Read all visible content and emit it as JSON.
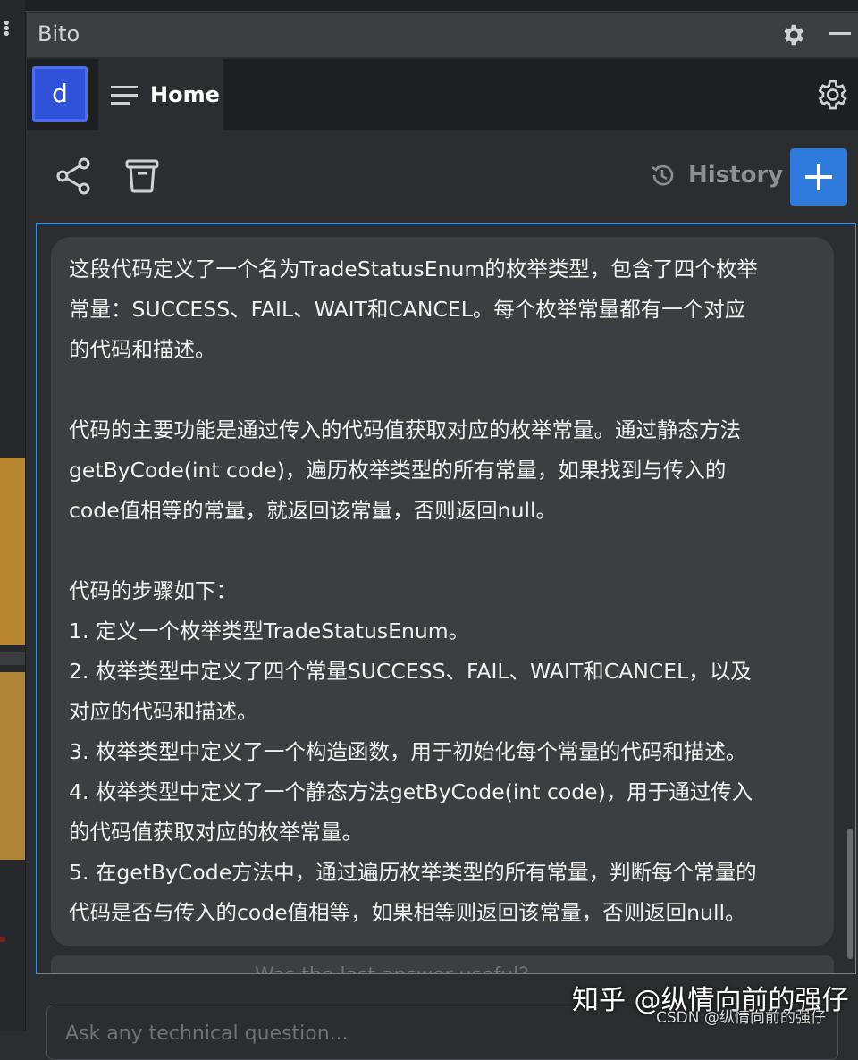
{
  "window": {
    "title": "Bito"
  },
  "tabs": {
    "avatar_letter": "d",
    "home_label": "Home"
  },
  "toolbar": {
    "history_label": "History"
  },
  "answer": {
    "lines": [
      "这段代码定义了一个名为TradeStatusEnum的枚举类型，包含了四个枚举",
      "常量：SUCCESS、FAIL、WAIT和CANCEL。每个枚举常量都有一个对应",
      "的代码和描述。",
      "",
      "代码的主要功能是通过传入的代码值获取对应的枚举常量。通过静态方法",
      "getByCode(int code)，遍历枚举类型的所有常量，如果找到与传入的",
      "code值相等的常量，就返回该常量，否则返回null。",
      "",
      "代码的步骤如下：",
      "1. 定义一个枚举类型TradeStatusEnum。",
      "2. 枚举类型中定义了四个常量SUCCESS、FAIL、WAIT和CANCEL，以及",
      "对应的代码和描述。",
      "3. 枚举类型中定义了一个构造函数，用于初始化每个常量的代码和描述。",
      "4. 枚举类型中定义了一个静态方法getByCode(int code)，用于通过传入",
      "的代码值获取对应的枚举常量。",
      "5. 在getByCode方法中，通过遍历枚举类型的所有常量，判断每个常量的",
      "代码是否与传入的code值相等，如果相等则返回该常量，否则返回null。"
    ]
  },
  "feedback": {
    "question": "Was the last answer useful?"
  },
  "input": {
    "placeholder": "Ask any technical question..."
  },
  "watermarks": {
    "zhihu": "知乎 @纵情向前的强仔",
    "csdn": "CSDN @纵情向前的强仔"
  },
  "colors": {
    "accent": "#2f7bdc",
    "avatar": "#3052d8",
    "frame": "#3e8fd6"
  }
}
